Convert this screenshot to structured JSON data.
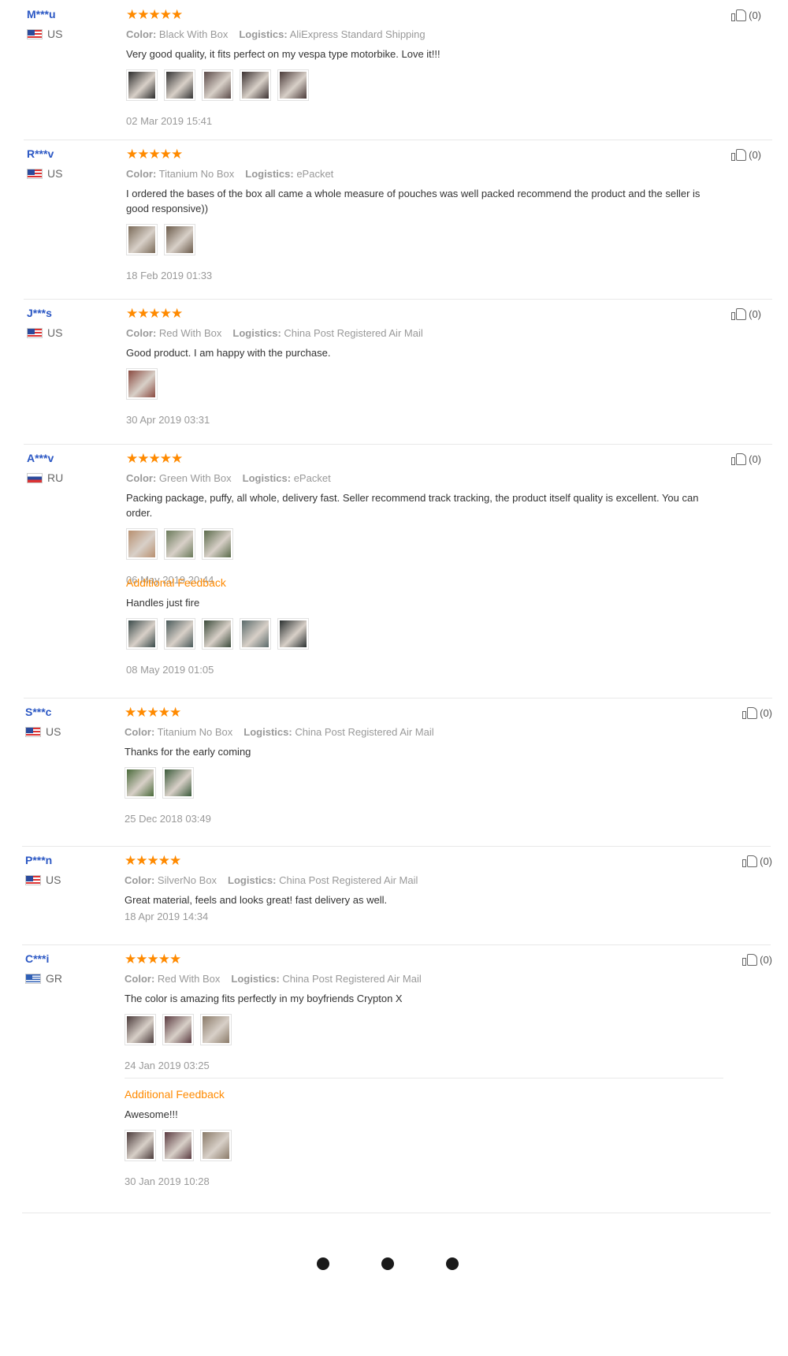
{
  "reviews": [
    {
      "user": "M***u",
      "country": "US",
      "flag": "us",
      "stars": "★★★★★",
      "color_label": "Color:",
      "color": "Black With Box",
      "logistics_label": "Logistics:",
      "logistics": "AliExpress Standard Shipping",
      "text": "Very good quality, it fits perfect on my vespa type motorbike. Love it!!!",
      "photos": [
        "#2a2a2a",
        "#333333",
        "#5a4a48",
        "#3a3030",
        "#4a3a38"
      ],
      "date": "02 Mar 2019 15:41",
      "likes": "(0)"
    },
    {
      "user": "R***v",
      "country": "US",
      "flag": "us",
      "stars": "★★★★★",
      "color_label": "Color:",
      "color": "Titanium No Box",
      "logistics_label": "Logistics:",
      "logistics": "ePacket",
      "text": "I ordered the bases of the box all came a whole measure of pouches was well packed recommend the product and the seller is good responsive))",
      "photos": [
        "#7a6a58",
        "#6a5a4a"
      ],
      "date": "18 Feb 2019 01:33",
      "likes": "(0)"
    },
    {
      "user": "J***s",
      "country": "US",
      "flag": "us",
      "stars": "★★★★★",
      "color_label": "Color:",
      "color": "Red With Box",
      "logistics_label": "Logistics:",
      "logistics": "China Post Registered Air Mail",
      "text": "Good product. I am happy with the purchase.",
      "photos": [
        "#8a4a40"
      ],
      "date": "30 Apr 2019 03:31",
      "likes": "(0)"
    },
    {
      "user": "A***v",
      "country": "RU",
      "flag": "ru",
      "stars": "★★★★★",
      "color_label": "Color:",
      "color": "Green With Box",
      "logistics_label": "Logistics:",
      "logistics": "ePacket",
      "text": "Packing package, puffy, all whole, delivery fast. Seller recommend track tracking, the product itself quality is excellent. You can order.",
      "photos": [
        "#b89070",
        "#6a7a5a",
        "#5a6a4a"
      ],
      "date": "06 May 2019 20:44",
      "additional_label": "Additional Feedback",
      "additional_text": "Handles just fire",
      "additional_photos": [
        "#3a4a4a",
        "#4a5a5a",
        "#3a4a3a",
        "#5a6a6a",
        "#2a3030"
      ],
      "additional_date": "08 May 2019 01:05",
      "likes": "(0)"
    },
    {
      "user": "S***c",
      "country": "US",
      "flag": "us",
      "stars": "★★★★★",
      "color_label": "Color:",
      "color": "Titanium No Box",
      "logistics_label": "Logistics:",
      "logistics": "China Post Registered Air Mail",
      "text": "Thanks for the early coming",
      "photos": [
        "#4a6a3a",
        "#3a5a3a"
      ],
      "date": "25 Dec 2018 03:49",
      "likes": "(0)"
    },
    {
      "user": "P***n",
      "country": "US",
      "flag": "us",
      "stars": "★★★★★",
      "color_label": "Color:",
      "color": "SilverNo Box",
      "logistics_label": "Logistics:",
      "logistics": "China Post Registered Air Mail",
      "text": "Great material, feels and looks great! fast delivery as well.",
      "photos": [],
      "date": "18 Apr 2019 14:34",
      "likes": "(0)"
    },
    {
      "user": "C***i",
      "country": "GR",
      "flag": "gr",
      "stars": "★★★★★",
      "color_label": "Color:",
      "color": "Red With Box",
      "logistics_label": "Logistics:",
      "logistics": "China Post Registered Air Mail",
      "text": "The color is amazing fits perfectly in my boyfriends Crypton X",
      "photos": [
        "#4a3a3a",
        "#5a3a40",
        "#8a7a68"
      ],
      "date": "24 Jan 2019 03:25",
      "additional_label": "Additional Feedback",
      "additional_text": "Awesome!!!",
      "additional_photos": [
        "#4a3a3a",
        "#5a3a40",
        "#8a7a68"
      ],
      "additional_date": "30 Jan 2019 10:28",
      "likes": "(0)"
    }
  ],
  "pagination": {
    "dots": 3
  }
}
